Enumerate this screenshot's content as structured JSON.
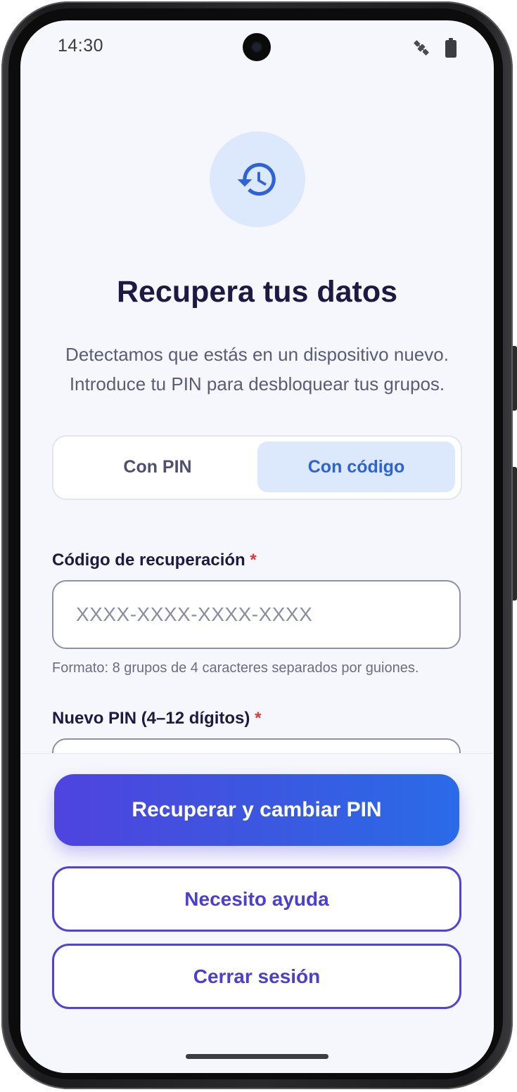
{
  "status_bar": {
    "time": "14:30",
    "icons": [
      "satellite-icon",
      "battery-icon"
    ]
  },
  "hero": {
    "icon": "history-icon",
    "title": "Recupera tus datos",
    "subtitle": "Detectamos que estás en un dispositivo nuevo. Introduce tu PIN para desbloquear tus grupos."
  },
  "tabs": [
    {
      "label": "Con PIN",
      "selected": false
    },
    {
      "label": "Con código",
      "selected": true
    }
  ],
  "recovery_code": {
    "label": "Código de recuperación",
    "required_mark": "*",
    "value": "",
    "placeholder": "XXXX-XXXX-XXXX-XXXX",
    "helper": "Formato: 8 grupos de 4 caracteres separados por guiones."
  },
  "new_pin": {
    "label": "Nuevo PIN (4–12 dígitos)",
    "required_mark": "*",
    "value": "",
    "icon": "eye-icon"
  },
  "actions": {
    "primary": "Recuperar y cambiar PIN",
    "help": "Necesito ayuda",
    "logout": "Cerrar sesión"
  },
  "colors": {
    "primary_gradient_start": "#4f43df",
    "primary_gradient_end": "#2a6be8",
    "accent_blue": "#2e62d9",
    "title": "#1c1a44",
    "required": "#d93a3a",
    "background": "#f6f7fc"
  }
}
